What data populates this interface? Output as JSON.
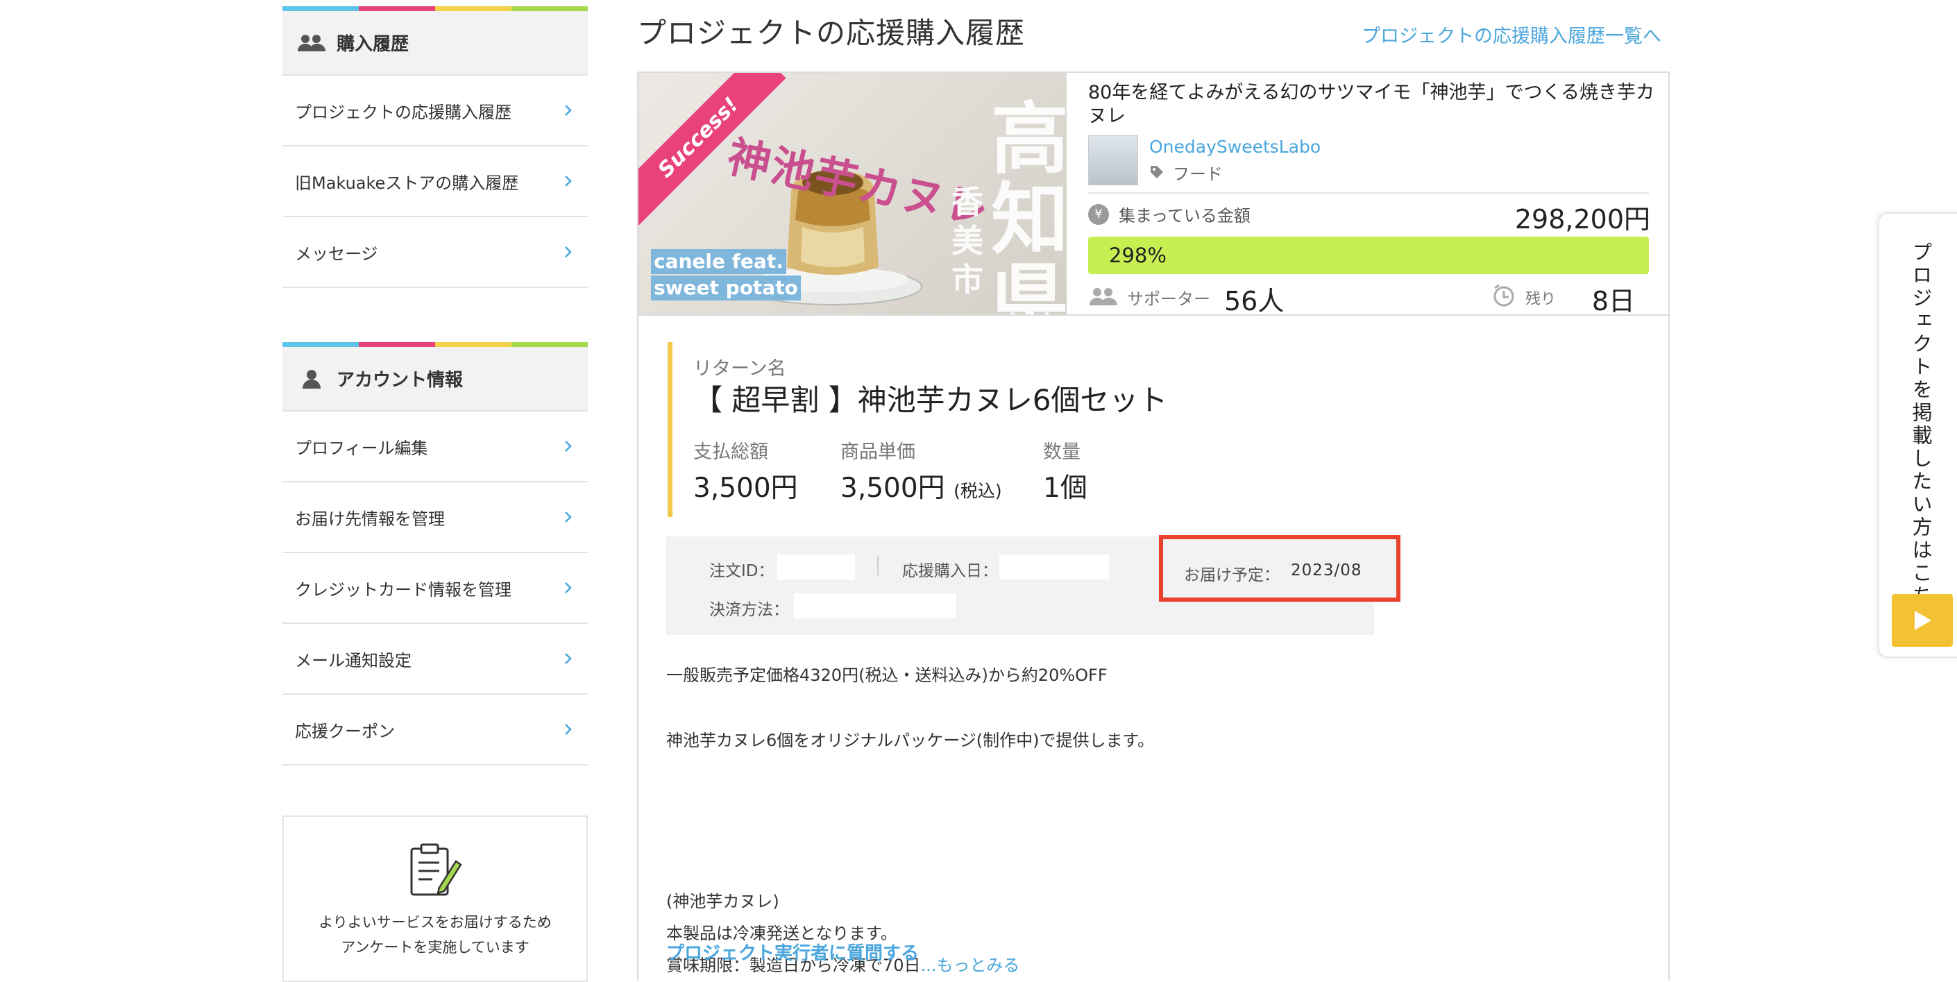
{
  "colors": {
    "link": "#4aa6dc",
    "accent_bar": [
      "#5bc4e8",
      "#e8417b",
      "#f2d24b",
      "#a6d94d"
    ],
    "progress": "#c7ef52",
    "highlight": "#e8422e",
    "return_border": "#f2c94c"
  },
  "sidebar": {
    "purchase": {
      "title": "購入履歴",
      "icon": "users-icon",
      "items": [
        {
          "label": "プロジェクトの応援購入履歴"
        },
        {
          "label": "旧Makuakeストアの購入履歴"
        },
        {
          "label": "メッセージ"
        }
      ]
    },
    "account": {
      "title": "アカウント情報",
      "icon": "person-icon",
      "items": [
        {
          "label": "プロフィール編集"
        },
        {
          "label": "お届け先情報を管理"
        },
        {
          "label": "クレジットカード情報を管理"
        },
        {
          "label": "メール通知設定"
        },
        {
          "label": "応援クーポン"
        }
      ]
    },
    "survey": {
      "icon": "clipboard-pen-icon",
      "line1": "よりよいサービスをお届けするため",
      "line2": "アンケートを実施しています"
    }
  },
  "main": {
    "title": "プロジェクトの応援購入履歴",
    "list_link": "プロジェクトの応援購入履歴一覧へ",
    "project": {
      "hero": {
        "ribbon": "Success!",
        "title_jp": "神池芋カヌレ",
        "region_big": "高知県",
        "region_small": "香美市",
        "en_line1": "canele feat.",
        "en_line2": "sweet potato"
      },
      "title": "80年を経てよみがえる幻のサツマイモ「神池芋」でつくる焼き芋カヌレ",
      "owner": "OnedaySweetsLabo",
      "category": "フード",
      "amount_label": "集まっている金額",
      "amount": "298,200円",
      "progress_text": "298%",
      "progress_pct": 100,
      "supporters_label": "サポーター",
      "supporters": "56人",
      "remaining_label": "残り",
      "remaining": "8日"
    },
    "return": {
      "label": "リターン名",
      "name": "【 超早割 】神池芋カヌレ6個セット",
      "total_label": "支払総額",
      "total": "3,500円",
      "unit_label": "商品単価",
      "unit": "3,500円",
      "unit_note": "(税込)",
      "qty_label": "数量",
      "qty": "1個"
    },
    "order": {
      "id_label": "注文ID：",
      "id_value": "",
      "date_label": "応援購入日：",
      "date_value": "",
      "payment_label": "決済方法：",
      "payment_value": "",
      "delivery_label": "お届け予定：",
      "delivery_value": "2023/08"
    },
    "description": {
      "line1": "一般販売予定価格4320円(税込・送料込み)から約20%OFF",
      "line2": "神池芋カヌレ6個をオリジナルパッケージ(制作中)で提供します。",
      "line3": "(神池芋カヌレ)",
      "line4": "本製品は冷凍発送となります。",
      "line5": "賞味期限：製造日から冷凍で70日",
      "more": "...もっとみる"
    },
    "ask_link": "プロジェクト実行者に質問する"
  },
  "float_tab": {
    "text": "プロジェクトを掲載したい方はこちら",
    "icon": "play-icon"
  }
}
